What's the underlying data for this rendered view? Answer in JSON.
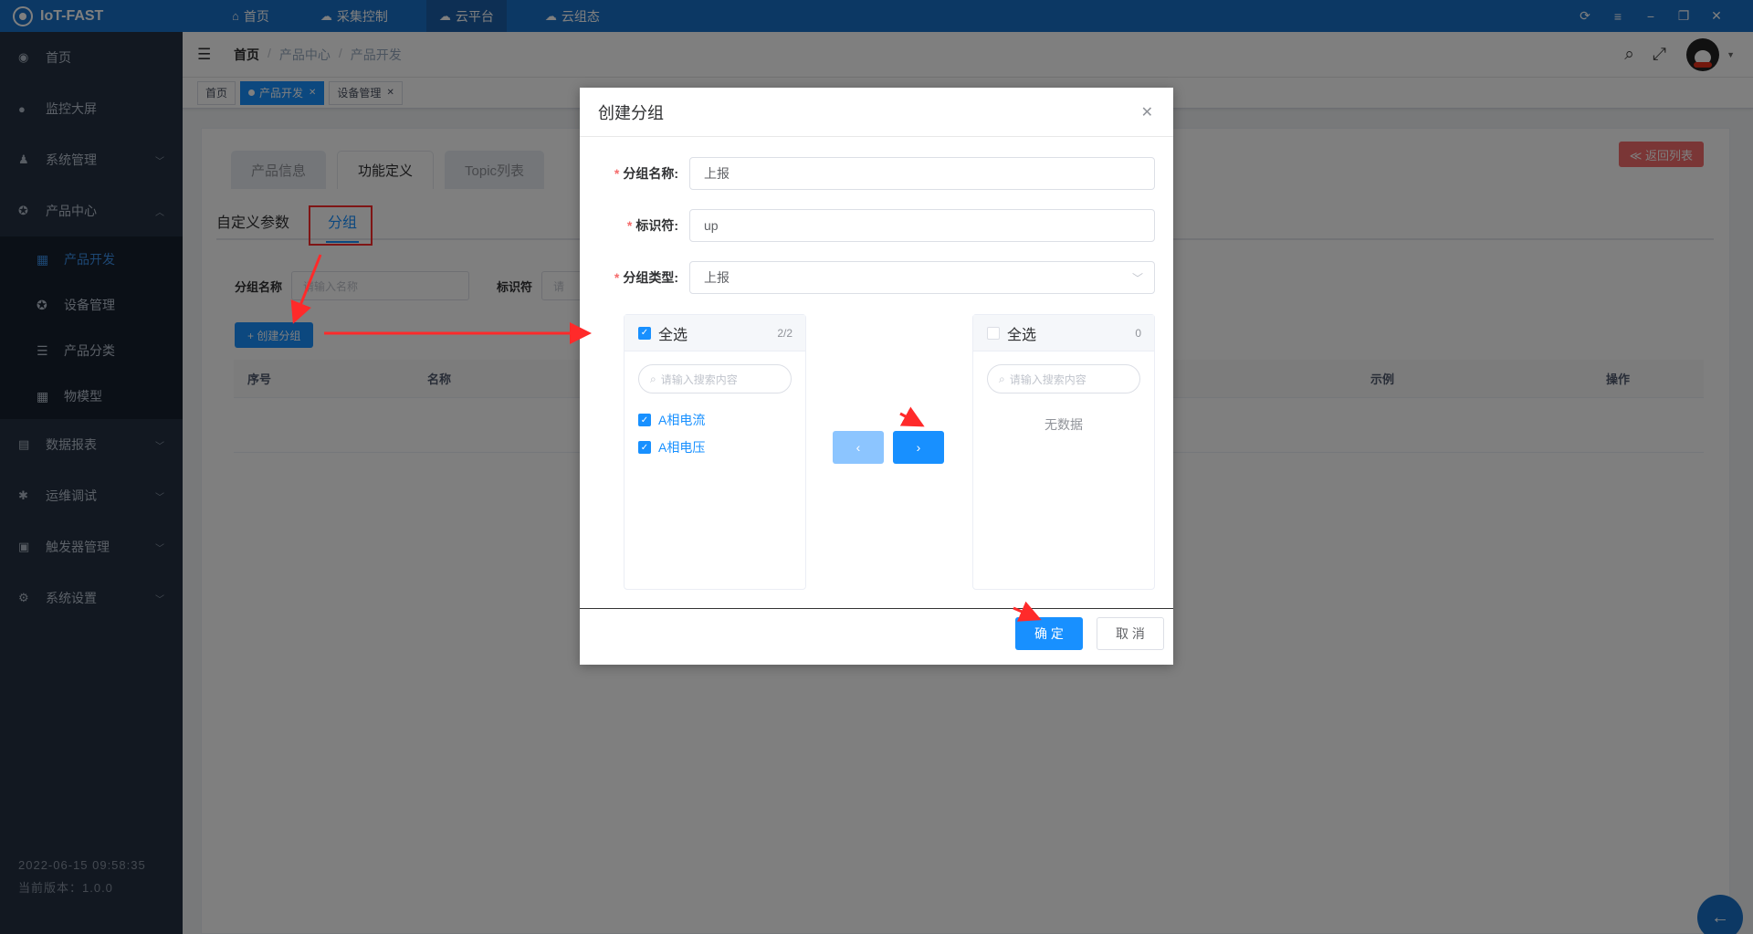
{
  "app": {
    "title": "IoT-FAST"
  },
  "topnav": [
    {
      "label": "首页",
      "icon": "home-icon"
    },
    {
      "label": "采集控制",
      "icon": "cloud-icon"
    },
    {
      "label": "云平台",
      "icon": "cloud-platform-icon"
    },
    {
      "label": "云组态",
      "icon": "cloud-config-icon"
    }
  ],
  "sidebar": {
    "items": [
      {
        "label": "首页"
      },
      {
        "label": "监控大屏"
      },
      {
        "label": "系统管理"
      },
      {
        "label": "产品中心"
      },
      {
        "label": "数据报表"
      },
      {
        "label": "运维调试"
      },
      {
        "label": "触发器管理"
      },
      {
        "label": "系统设置"
      }
    ],
    "subitems": [
      {
        "label": "产品开发"
      },
      {
        "label": "设备管理"
      },
      {
        "label": "产品分类"
      },
      {
        "label": "物模型"
      }
    ],
    "datetime": "2022-06-15 09:58:35",
    "version": "当前版本：1.0.0"
  },
  "breadcrumb": [
    "首页",
    "产品中心",
    "产品开发"
  ],
  "tags": [
    {
      "label": "首页"
    },
    {
      "label": "产品开发"
    },
    {
      "label": "设备管理"
    }
  ],
  "main": {
    "tabs": [
      "产品信息",
      "功能定义",
      "Topic列表"
    ],
    "return_label": "≪ 返回列表",
    "subtabs": [
      "自定义参数",
      "分组"
    ],
    "search": {
      "name_label": "分组名称",
      "name_placeholder": "请输入名称",
      "id_label": "标识符",
      "id_placeholder": "请"
    },
    "create_label": "+ 创建分组",
    "columns": [
      "序号",
      "名称",
      "示例",
      "操作"
    ]
  },
  "dialog": {
    "title": "创建分组",
    "fields": [
      {
        "label": "分组名称:",
        "value": "上报"
      },
      {
        "label": "标识符:",
        "value": "up"
      },
      {
        "label": "分组类型:",
        "value": "上报"
      }
    ],
    "left_panel": {
      "title": "全选",
      "count": "2/2",
      "search_placeholder": "请输入搜索内容",
      "items": [
        "A相电流",
        "A相电压"
      ]
    },
    "right_panel": {
      "title": "全选",
      "count": "0",
      "search_placeholder": "请输入搜索内容",
      "empty": "无数据"
    },
    "ok_label": "确 定",
    "cancel_label": "取 消"
  },
  "colors": {
    "primary": "#1890ff",
    "topbar": "#1970c8",
    "sidebar": "#243142",
    "danger": "#f56c6c",
    "annotation": "#ff2a2a"
  }
}
